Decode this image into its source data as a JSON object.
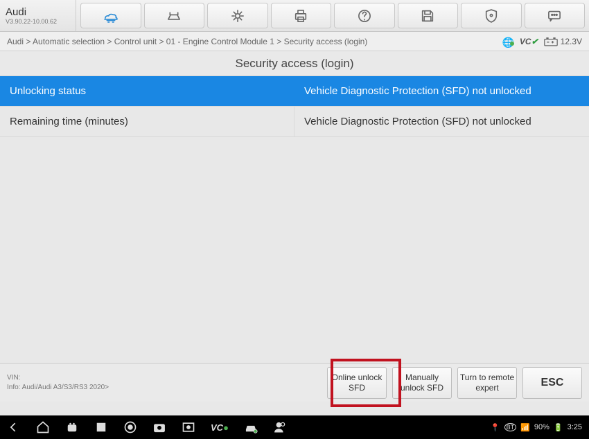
{
  "brand": {
    "name": "Audi",
    "version": "V3.90.22-10.00.62"
  },
  "breadcrumb": "Audi > Automatic selection > Control unit > 01 - Engine Control Module 1 > Security access (login)",
  "status": {
    "vci_label": "VC",
    "voltage": "12.3V"
  },
  "page_title": "Security access (login)",
  "rows": [
    {
      "label": "Unlocking status",
      "value": "Vehicle Diagnostic Protection (SFD) not unlocked",
      "highlight": true
    },
    {
      "label": "Remaining time (minutes)",
      "value": "Vehicle Diagnostic Protection (SFD) not unlocked",
      "highlight": false
    }
  ],
  "footer_info": {
    "vin_label": "VIN:",
    "info_line": "Info: Audi/Audi A3/S3/RS3 2020>"
  },
  "buttons": {
    "online": "Online unlock SFD",
    "manual": "Manually unlock SFD",
    "remote": "Turn to remote expert",
    "esc": "ESC"
  },
  "android": {
    "battery": "90%",
    "time": "3:25"
  }
}
